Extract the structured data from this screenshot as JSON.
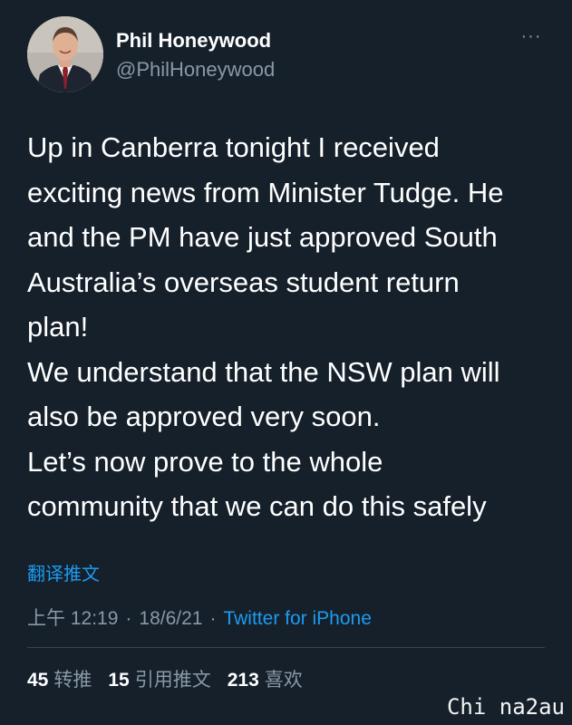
{
  "tweet": {
    "author": {
      "name": "Phil Honeywood",
      "handle": "@PhilHoneywood"
    },
    "more_icon": "···",
    "text_lines": [
      "Up in Canberra tonight I received",
      "exciting news from Minister Tudge. He",
      "and the PM have just approved South",
      "Australia’s overseas student return",
      "plan!",
      "We understand that the NSW plan will",
      "also be approved very soon.",
      "Let’s now prove to the whole",
      "community that we can do this safely"
    ],
    "translate_label": "翻译推文",
    "time": "上午 12:19",
    "date": "18/6/21",
    "separator": "·",
    "source": "Twitter for iPhone",
    "stats": {
      "retweets_count": "45",
      "retweets_label": "转推",
      "quotes_count": "15",
      "quotes_label": "引用推文",
      "likes_count": "213",
      "likes_label": "喜欢"
    }
  },
  "watermark": "Chi na2au",
  "colors": {
    "background": "#15202b",
    "text_primary": "#ffffff",
    "text_secondary": "#8899a6",
    "accent": "#1d9bf0"
  }
}
